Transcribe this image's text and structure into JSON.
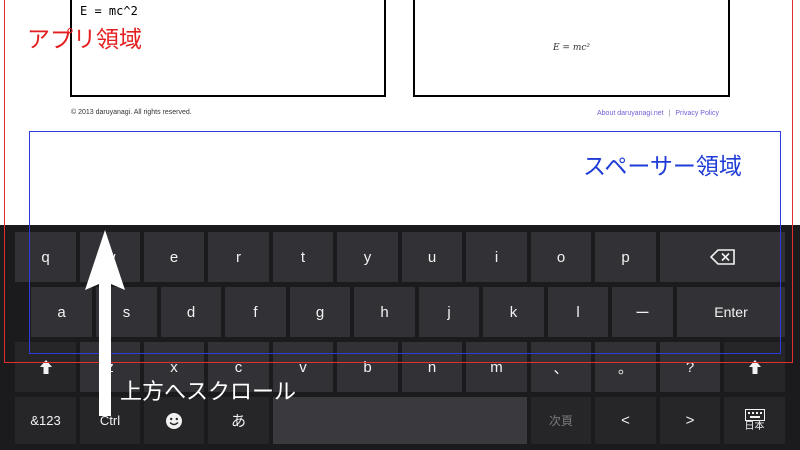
{
  "app": {
    "code_text": "E = mc^2",
    "math_text": "E = mc²",
    "copyright": "© 2013 daruyanagi. All rights reserved.",
    "about_link": "About daruyanagi.net",
    "link_separator": "|",
    "privacy_link": "Privacy Policy"
  },
  "annotations": {
    "app_area_label": "アプリ領域",
    "spacer_area_label": "スペーサー領域",
    "scroll_label": "上方へスクロール",
    "app_area_color": "#e41e1e",
    "spacer_area_color": "#1f3cd6"
  },
  "keyboard": {
    "row1": [
      "q",
      "w",
      "e",
      "r",
      "t",
      "y",
      "u",
      "i",
      "o",
      "p"
    ],
    "backspace_icon": "backspace-icon",
    "row2": [
      "a",
      "s",
      "d",
      "f",
      "g",
      "h",
      "j",
      "k",
      "l",
      "ー"
    ],
    "enter": "Enter",
    "shift_icon": "shift-arrow-icon",
    "row3": [
      "z",
      "x",
      "c",
      "v",
      "b",
      "n",
      "m",
      "、",
      "。",
      "?"
    ],
    "row4": {
      "num": "&123",
      "ctrl": "Ctrl",
      "emoji_icon": "smiley-icon",
      "kana": "あ",
      "next_page": "次頁",
      "left_arrow": "<",
      "right_arrow": ">",
      "lang_icon": "keyboard-icon",
      "lang": "日本"
    }
  }
}
